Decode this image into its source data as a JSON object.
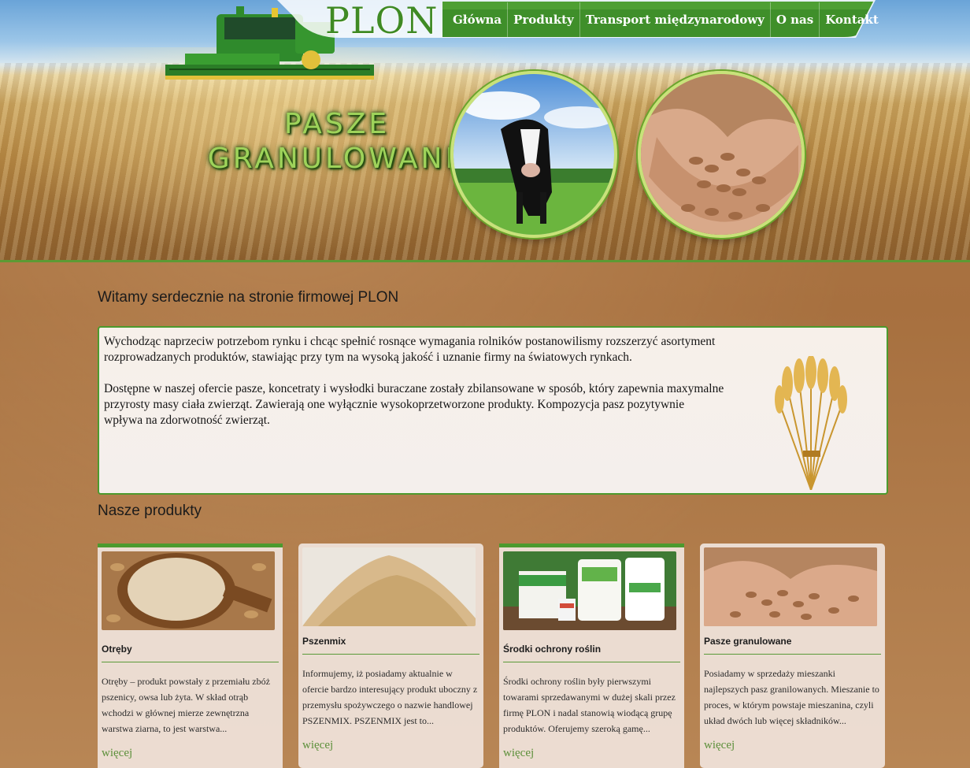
{
  "brand": {
    "logo_text": "PLON"
  },
  "nav": {
    "items": [
      {
        "label": "Główna"
      },
      {
        "label": "Produkty"
      },
      {
        "label": "Transport międzynarodowy"
      },
      {
        "label": "O nas"
      },
      {
        "label": "Kontakt"
      }
    ]
  },
  "hero": {
    "title_line1": "PASZE",
    "title_line2": "GRANULOWANE"
  },
  "welcome": {
    "heading": "Witamy serdecznie na stronie firmowej PLON"
  },
  "intro": {
    "paragraph1": "Wychodząc naprzeciw potrzebom rynku i chcąc spełnić rosnące wymagania rolników postanowilismy rozszerzyć asortyment rozprowadzanych produktów, stawiając przy tym na wysoką jakość i uznanie firmy na światowych rynkach.",
    "paragraph2": "Dostępne w naszej ofercie pasze, koncetraty i wysłodki buraczane zostały zbilansowane w sposób, który zapewnia maxymalne przyrosty masy ciała zwierząt. Zawierają one wyłącznie wysokoprzetworzone produkty. Kompozycja pasz pozytywnie wpływa na zdorwotność zwierząt."
  },
  "products": {
    "heading": "Nasze produkty",
    "more_label": "więcej",
    "items": [
      {
        "name": "Otręby",
        "description": "Otręby – produkt powstały z przemiału zbóż pszenicy, owsa lub żyta. W skład otrąb wchodzi w głównej mierze zewnętrzna warstwa ziarna, to jest warstwa..."
      },
      {
        "name": "Pszenmix",
        "description": "Informujemy, iż posiadamy aktualnie w ofercie bardzo interesujący produkt uboczny z przemysłu spożywczego o nazwie handlowej PSZENMIX. PSZENMIX jest to..."
      },
      {
        "name": "Środki ochrony roślin",
        "description": "Środki ochrony roślin były pierwszymi towarami sprzedawanymi w dużej skali przez firmę PLON i nadal stanowią wiodącą grupę produktów. Oferujemy szeroką gamę..."
      },
      {
        "name": "Pasze granulowane",
        "description": "Posiadamy w sprzedaży mieszanki najlepszych pasz granilowanych. Mieszanie to proces, w którym powstaje mieszanina, czyli układ dwóch lub więcej składników..."
      }
    ]
  },
  "colors": {
    "accent_green": "#4c9a2e",
    "nav_green": "#3f8a24",
    "link_green": "#5c8f3a"
  }
}
